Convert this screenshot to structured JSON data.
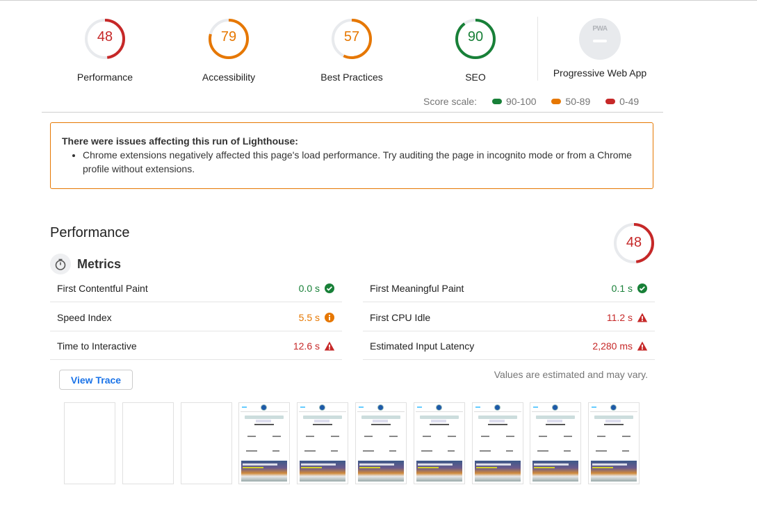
{
  "gauges": [
    {
      "label": "Performance",
      "score": 48,
      "color": "#c62828"
    },
    {
      "label": "Accessibility",
      "score": 79,
      "color": "#e67700"
    },
    {
      "label": "Best Practices",
      "score": 57,
      "color": "#e67700"
    },
    {
      "label": "SEO",
      "score": 90,
      "color": "#188038"
    }
  ],
  "pwa": {
    "badge_text": "PWA",
    "label": "Progressive Web App"
  },
  "score_scale": {
    "label": "Score scale:",
    "ranges": [
      {
        "label": "90-100",
        "color": "#188038"
      },
      {
        "label": "50-89",
        "color": "#e67700"
      },
      {
        "label": "0-49",
        "color": "#c62828"
      }
    ]
  },
  "warning": {
    "title": "There were issues affecting this run of Lighthouse:",
    "items": [
      "Chrome extensions negatively affected this page's load performance. Try auditing the page in incognito mode or from a Chrome profile without extensions."
    ]
  },
  "performance": {
    "title": "Performance",
    "score": 48,
    "metrics_title": "Metrics",
    "metrics_left": [
      {
        "name": "First Contentful Paint",
        "value": "0.0 s",
        "status": "pass"
      },
      {
        "name": "Speed Index",
        "value": "5.5 s",
        "status": "average"
      },
      {
        "name": "Time to Interactive",
        "value": "12.6 s",
        "status": "fail"
      }
    ],
    "metrics_right": [
      {
        "name": "First Meaningful Paint",
        "value": "0.1 s",
        "status": "pass"
      },
      {
        "name": "First CPU Idle",
        "value": "11.2 s",
        "status": "fail"
      },
      {
        "name": "Estimated Input Latency",
        "value": "2,280 ms",
        "status": "fail"
      }
    ],
    "disclaimer": "Values are estimated and may vary.",
    "view_trace_label": "View Trace",
    "filmstrip": [
      "blank",
      "blank",
      "blank",
      "loaded",
      "loaded",
      "loaded",
      "loaded",
      "loaded",
      "loaded",
      "loaded"
    ]
  },
  "status_colors": {
    "pass": "#188038",
    "average": "#e67700",
    "fail": "#c62828"
  }
}
